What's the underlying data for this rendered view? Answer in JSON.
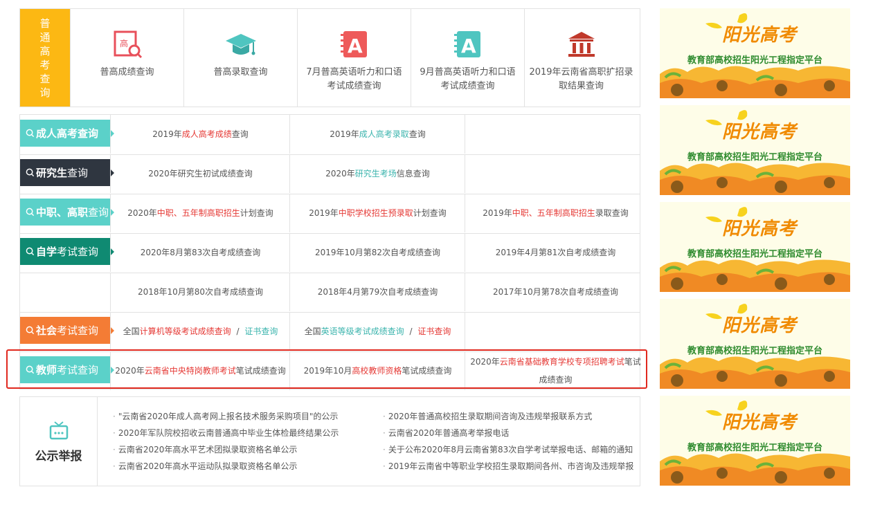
{
  "top": {
    "side_label": [
      "普",
      "通",
      "高",
      "考",
      "查",
      "询"
    ],
    "items": [
      {
        "label": "普高成绩查询",
        "icon": "magnifier-document-icon"
      },
      {
        "label": "普高录取查询",
        "icon": "graduation-cap-icon"
      },
      {
        "label": "7月普高英语听力和口语考试成绩查询",
        "icon": "english-book-a-red-icon"
      },
      {
        "label": "9月普高英语听力和口语考试成绩查询",
        "icon": "english-book-a-teal-icon"
      },
      {
        "label": "2019年云南省高职扩招录取结果查询",
        "icon": "institution-building-icon"
      }
    ]
  },
  "rows": [
    {
      "tag": {
        "bold": "成人高考查询",
        "rest": "",
        "color": "#5bd1c9"
      },
      "cells": [
        [
          {
            "t": "2019年"
          },
          {
            "t": "成人高考成绩",
            "c": "red"
          },
          {
            "t": "查询"
          }
        ],
        [
          {
            "t": "2019年"
          },
          {
            "t": "成人高考录取",
            "c": "teal"
          },
          {
            "t": "查询"
          }
        ],
        []
      ]
    },
    {
      "tag": {
        "bold": "研究生",
        "rest": "查询",
        "color": "#2f3640"
      },
      "cells": [
        [
          {
            "t": "2020年研究生初试成绩查询"
          }
        ],
        [
          {
            "t": "2020年"
          },
          {
            "t": "研究生考场",
            "c": "teal"
          },
          {
            "t": "信息查询"
          }
        ],
        []
      ]
    },
    {
      "tag": {
        "bold": "中职、高职",
        "rest": "查询",
        "color": "#5bd1c9"
      },
      "cells": [
        [
          {
            "t": "2020年"
          },
          {
            "t": "中职、五年制高职招生",
            "c": "red"
          },
          {
            "t": "计划查询"
          }
        ],
        [
          {
            "t": "2019年"
          },
          {
            "t": "中职学校招生预录取",
            "c": "red"
          },
          {
            "t": "计划查询"
          }
        ],
        [
          {
            "t": "2019年"
          },
          {
            "t": "中职、五年制高职招生",
            "c": "red"
          },
          {
            "t": "录取查询"
          }
        ]
      ]
    },
    {
      "tag": {
        "bold": "自学",
        "rest": "考试查询",
        "color": "#0f8a72"
      },
      "cells": [
        [
          {
            "t": "2020年8月第83次自考成绩查询"
          }
        ],
        [
          {
            "t": "2019年10月第82次自考成绩查询"
          }
        ],
        [
          {
            "t": "2019年4月第81次自考成绩查询"
          }
        ]
      ]
    },
    {
      "tag": null,
      "cells": [
        [
          {
            "t": "2018年10月第80次自考成绩查询"
          }
        ],
        [
          {
            "t": "2018年4月第79次自考成绩查询"
          }
        ],
        [
          {
            "t": "2017年10月第78次自考成绩查询"
          }
        ]
      ]
    },
    {
      "tag": {
        "bold": "社会",
        "rest": "考试查询",
        "color": "#f47c35"
      },
      "cells": [
        [
          {
            "t": "全国"
          },
          {
            "t": "计算机等级考试成绩查询",
            "c": "red"
          },
          {
            "t": " / ",
            "c": "sep"
          },
          {
            "t": "证书查询",
            "c": "teal"
          }
        ],
        [
          {
            "t": "全国"
          },
          {
            "t": "英语等级考试成绩查询",
            "c": "teal"
          },
          {
            "t": " / ",
            "c": "sep"
          },
          {
            "t": "证书查询",
            "c": "red"
          }
        ],
        []
      ]
    },
    {
      "tag": {
        "bold": "教师",
        "rest": "考试查询",
        "color": "#5bd1c9"
      },
      "cells": [
        [
          {
            "t": "2020年"
          },
          {
            "t": "云南省中央特岗教师考试",
            "c": "red"
          },
          {
            "t": "笔试成绩查询"
          }
        ],
        [
          {
            "t": "2019年10月"
          },
          {
            "t": "高校教师资格",
            "c": "red"
          },
          {
            "t": "笔试成绩查询"
          }
        ],
        [
          {
            "t": "2020年"
          },
          {
            "t": "云南省基础教育学校专项招聘考试",
            "c": "red"
          },
          {
            "t": "笔试成绩查询"
          }
        ]
      ]
    }
  ],
  "notice": {
    "title": "公示举报",
    "left": [
      "\"云南省2020年成人高考网上报名技术服务采购项目\"的公示",
      "2020年军队院校招收云南普通高中毕业生体检最终结果公示",
      "云南省2020年高水平艺术团拟录取资格名单公示",
      "云南省2020年高水平运动队拟录取资格名单公示"
    ],
    "right": [
      "2020年普通高校招生录取期间咨询及违规举报联系方式",
      "云南省2020年普通高考举报电话",
      "关于公布2020年8月云南省第83次自学考试举报电话、邮箱的通知",
      "2019年云南省中等职业学校招生录取期间各州、市咨询及违规举报"
    ]
  },
  "banners": [
    {
      "title": "阳光高考",
      "subtitle": "教育部高校招生阳光工程指定平台"
    },
    {
      "title": "阳光高考",
      "subtitle": "教育部高校招生阳光工程指定平台"
    },
    {
      "title": "阳光高考",
      "subtitle": "教育部高校招生阳光工程指定平台"
    },
    {
      "title": "阳光高考",
      "subtitle": "教育部高校招生阳光工程指定平台"
    },
    {
      "title": "阳光高考",
      "subtitle": "教育部高校招生阳光工程指定平台"
    }
  ],
  "colors": {
    "accent_yellow": "#fcb813",
    "highlight_red": "#e0281e",
    "text_red": "#e53935",
    "text_teal": "#3bb4ad"
  }
}
